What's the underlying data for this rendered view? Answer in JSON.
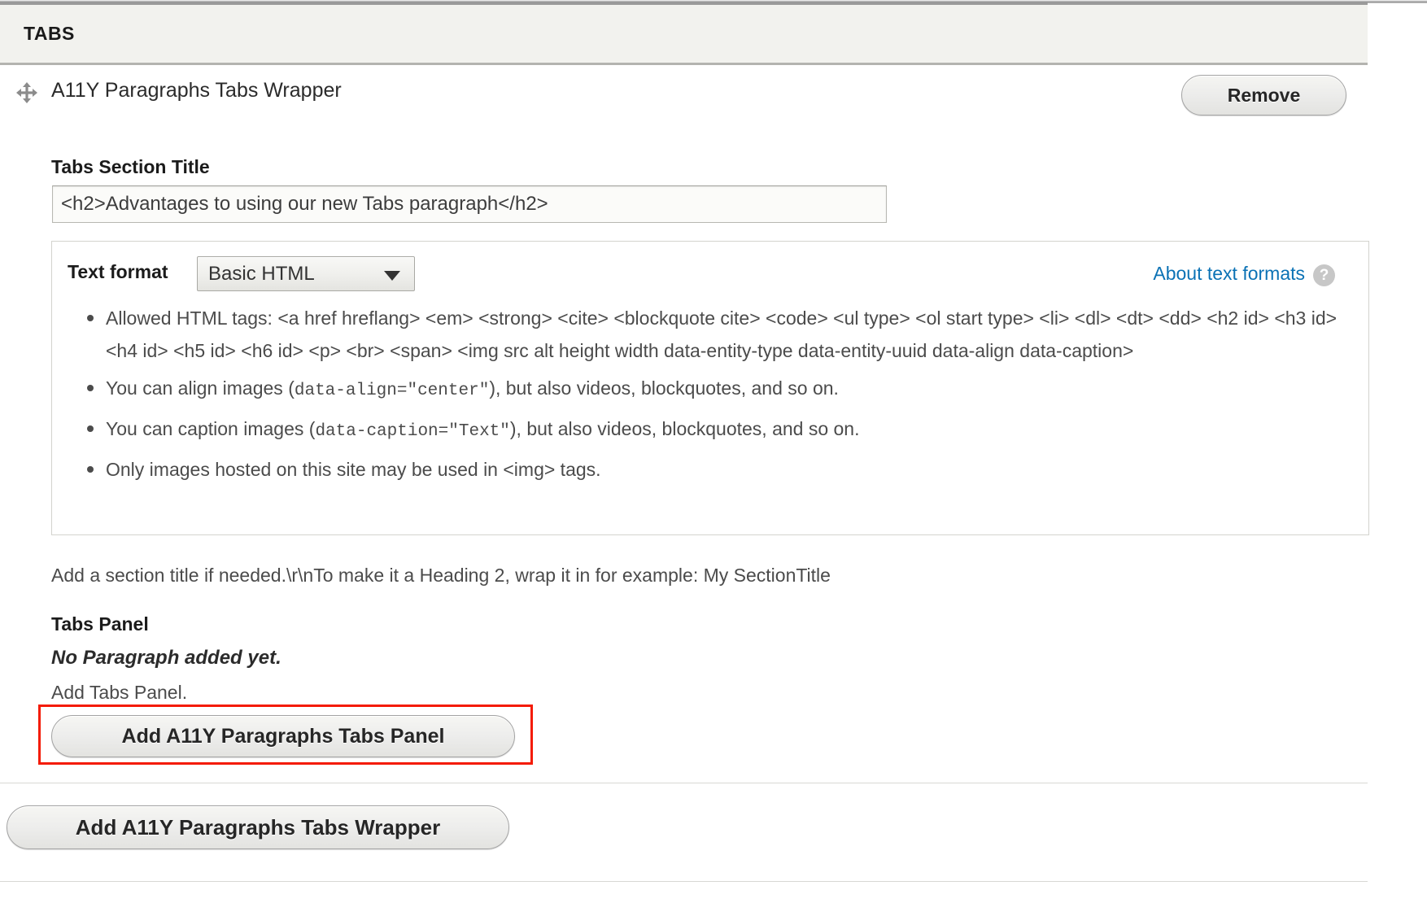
{
  "section": {
    "header_title": "TABS"
  },
  "paragraph": {
    "drag_handle_icon": "move-arrows-icon",
    "label": "A11Y Paragraphs Tabs Wrapper",
    "remove_label": "Remove"
  },
  "section_title_field": {
    "label": "Tabs Section Title",
    "value": "<h2>Advantages to using our new Tabs paragraph</h2>",
    "placeholder": ""
  },
  "text_format": {
    "label": "Text format",
    "selected": "Basic HTML",
    "options": [
      "Basic HTML"
    ],
    "caret_icon": "chevron-down-icon",
    "about_link": "About text formats",
    "help_icon": "question-mark-icon",
    "help_glyph": "?",
    "tips": [
      {
        "parts": [
          {
            "text": "Allowed HTML tags: <a href hreflang> <em> <strong> <cite> <blockquote cite> <code> <ul type> <ol start type> <li> <dl> <dt> <dd> <h2 id> <h3 id> <h4 id> <h5 id> <h6 id> <p> <br> <span> <img src alt height width data-entity-type data-entity-uuid data-align data-caption>",
            "mono": false
          }
        ]
      },
      {
        "parts": [
          {
            "text": "You can align images (",
            "mono": false
          },
          {
            "text": "data-align=\"center\"",
            "mono": true
          },
          {
            "text": "), but also videos, blockquotes, and so on.",
            "mono": false
          }
        ]
      },
      {
        "parts": [
          {
            "text": "You can caption images (",
            "mono": false
          },
          {
            "text": "data-caption=\"Text\"",
            "mono": true
          },
          {
            "text": "), but also videos, blockquotes, and so on.",
            "mono": false
          }
        ]
      },
      {
        "parts": [
          {
            "text": "Only images hosted on this site may be used in <img> tags.",
            "mono": false
          }
        ]
      }
    ]
  },
  "description": "Add a section title if needed.\\r\\nTo make it a Heading 2, wrap it in for example: My SectionTitle",
  "tabs_panel": {
    "label": "Tabs Panel",
    "empty_message": "No Paragraph added yet.",
    "add_hint": "Add Tabs Panel.",
    "add_button_label": "Add A11Y Paragraphs Tabs Panel",
    "highlight_color": "#f41b05"
  },
  "footer": {
    "add_wrapper_label": "Add A11Y Paragraphs Tabs Wrapper"
  },
  "colors": {
    "header_bg": "#f2f2ee",
    "link": "#0b72b5",
    "text": "#4b4b4b",
    "highlight": "#f41b05"
  }
}
